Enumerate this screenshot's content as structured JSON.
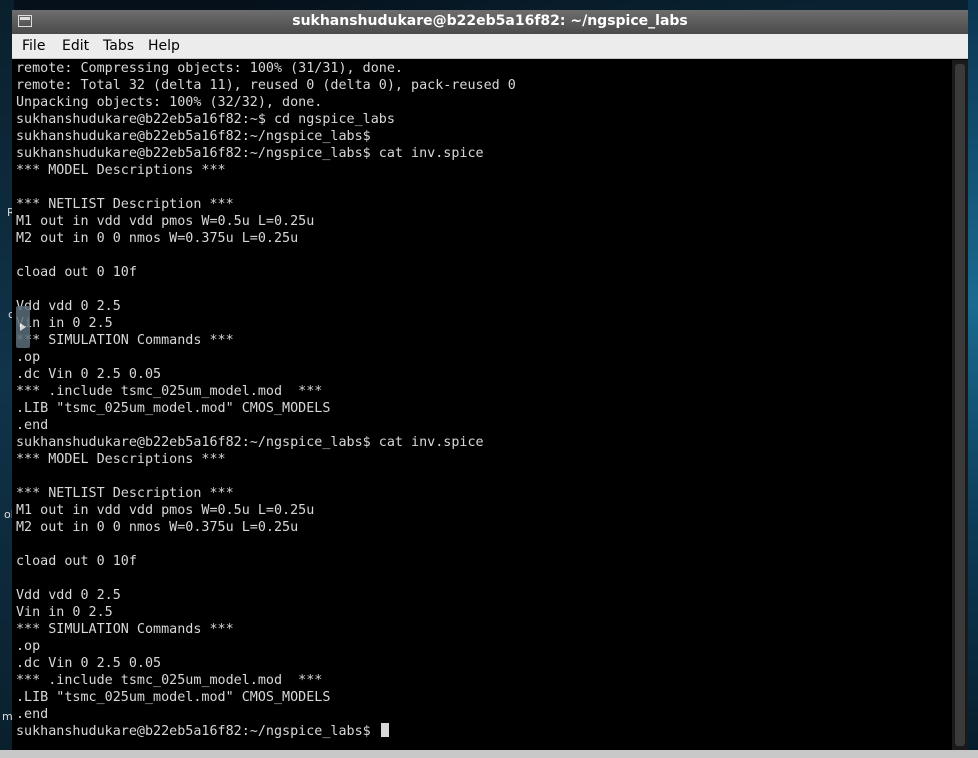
{
  "window": {
    "title": "sukhanshudukare@b22eb5a16f82: ~/ngspice_labs"
  },
  "menubar": {
    "items": [
      "File",
      "Edit",
      "Tabs",
      "Help"
    ]
  },
  "desktop_labels": [
    "R",
    "c",
    "ol",
    "m"
  ],
  "terminal": {
    "lines": [
      "remote: Compressing objects: 100% (31/31), done.",
      "remote: Total 32 (delta 11), reused 0 (delta 0), pack-reused 0",
      "Unpacking objects: 100% (32/32), done.",
      "sukhanshudukare@b22eb5a16f82:~$ cd ngspice_labs",
      "sukhanshudukare@b22eb5a16f82:~/ngspice_labs$",
      "sukhanshudukare@b22eb5a16f82:~/ngspice_labs$ cat inv.spice",
      "*** MODEL Descriptions ***",
      "",
      "*** NETLIST Description ***",
      "M1 out in vdd vdd pmos W=0.5u L=0.25u",
      "M2 out in 0 0 nmos W=0.375u L=0.25u",
      "",
      "cload out 0 10f",
      "",
      "Vdd vdd 0 2.5",
      "Vin in 0 2.5",
      "*** SIMULATION Commands ***",
      ".op",
      ".dc Vin 0 2.5 0.05",
      "*** .include tsmc_025um_model.mod  ***",
      ".LIB \"tsmc_025um_model.mod\" CMOS_MODELS",
      ".end",
      "sukhanshudukare@b22eb5a16f82:~/ngspice_labs$ cat inv.spice",
      "*** MODEL Descriptions ***",
      "",
      "*** NETLIST Description ***",
      "M1 out in vdd vdd pmos W=0.5u L=0.25u",
      "M2 out in 0 0 nmos W=0.375u L=0.25u",
      "",
      "cload out 0 10f",
      "",
      "Vdd vdd 0 2.5",
      "Vin in 0 2.5",
      "*** SIMULATION Commands ***",
      ".op",
      ".dc Vin 0 2.5 0.05",
      "*** .include tsmc_025um_model.mod  ***",
      ".LIB \"tsmc_025um_model.mod\" CMOS_MODELS",
      ".end"
    ],
    "prompt": "sukhanshudukare@b22eb5a16f82:~/ngspice_labs$ "
  },
  "colors": {
    "terminal_bg": "#000000",
    "terminal_fg": "#d8d8d8",
    "titlebar": "#5a5a5a",
    "menubar": "#ececec"
  },
  "icons": [
    "window-menu-icon",
    "cursor-block-icon",
    "side-panel-handle-icon"
  ]
}
